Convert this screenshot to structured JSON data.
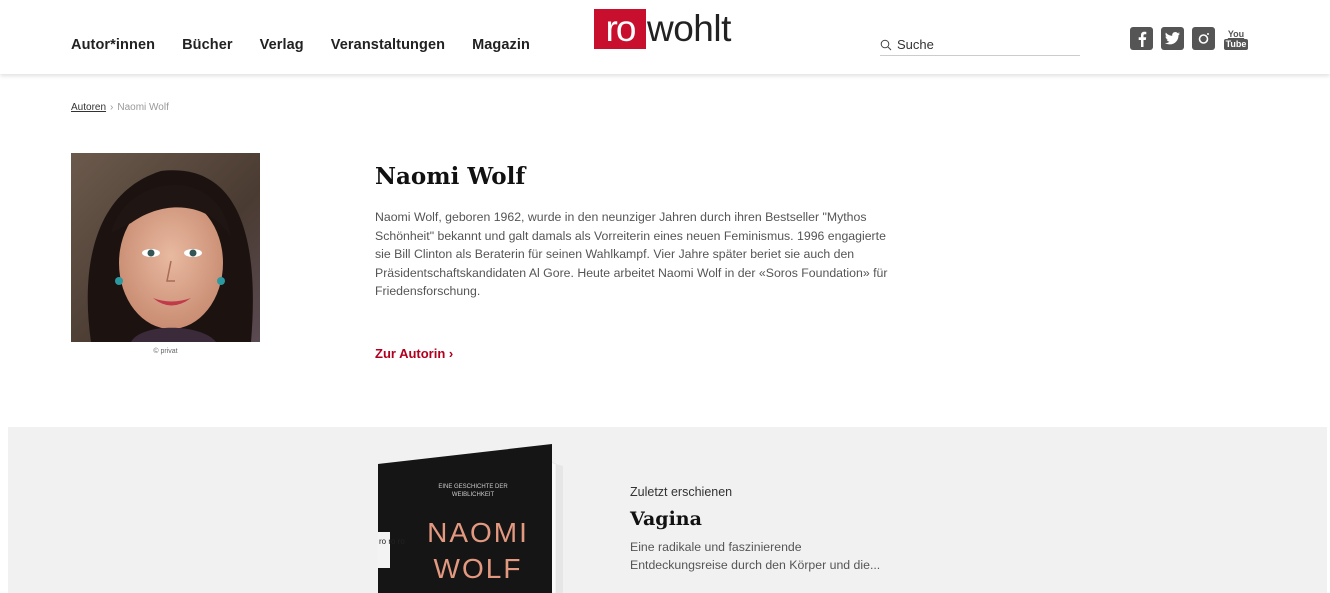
{
  "header": {
    "nav": [
      {
        "label": "Autor*innen"
      },
      {
        "label": "Bücher"
      },
      {
        "label": "Verlag"
      },
      {
        "label": "Veranstaltungen"
      },
      {
        "label": "Magazin"
      }
    ],
    "logo": {
      "part1": "ro",
      "part2": "wohlt"
    },
    "search": {
      "placeholder": "Suche"
    },
    "social": [
      "facebook-icon",
      "twitter-icon",
      "instagram-icon",
      "youtube-icon"
    ],
    "youtube_label_top": "You",
    "youtube_label_bottom": "Tube"
  },
  "breadcrumb": {
    "parent": "Autoren",
    "current": "Naomi Wolf"
  },
  "author": {
    "name": "Naomi Wolf",
    "photo_credit": "© privat",
    "bio": "Naomi Wolf, geboren 1962, wurde in den neunziger Jahren durch ihren Bestseller \"Mythos Schönheit\" bekannt und galt damals als Vorreiterin eines neuen Feminismus. 1996 engagierte sie Bill Clinton als Beraterin für seinen Wahlkampf. Vier Jahre später beriet sie auch den Präsidentschaftskandidaten Al Gore. Heute arbeitet Naomi Wolf in der «Soros Foundation» für Friedensforschung.",
    "link": "Zur Autorin ›"
  },
  "latest_book": {
    "label": "Zuletzt erschienen",
    "title": "Vagina",
    "description": "Eine radikale und faszinierende Entdeckungsreise durch den Körper und die...",
    "cover": {
      "subtitle_line1": "EINE GESCHICHTE DER",
      "subtitle_line2": "WEIBLICHKEIT",
      "author_line1": "NAOMI",
      "author_line2": "WOLF",
      "publisher_mark": "ro ro ro"
    }
  },
  "colors": {
    "accent": "#c8102e",
    "link": "#b0001e",
    "band": "#f1f1f1"
  }
}
